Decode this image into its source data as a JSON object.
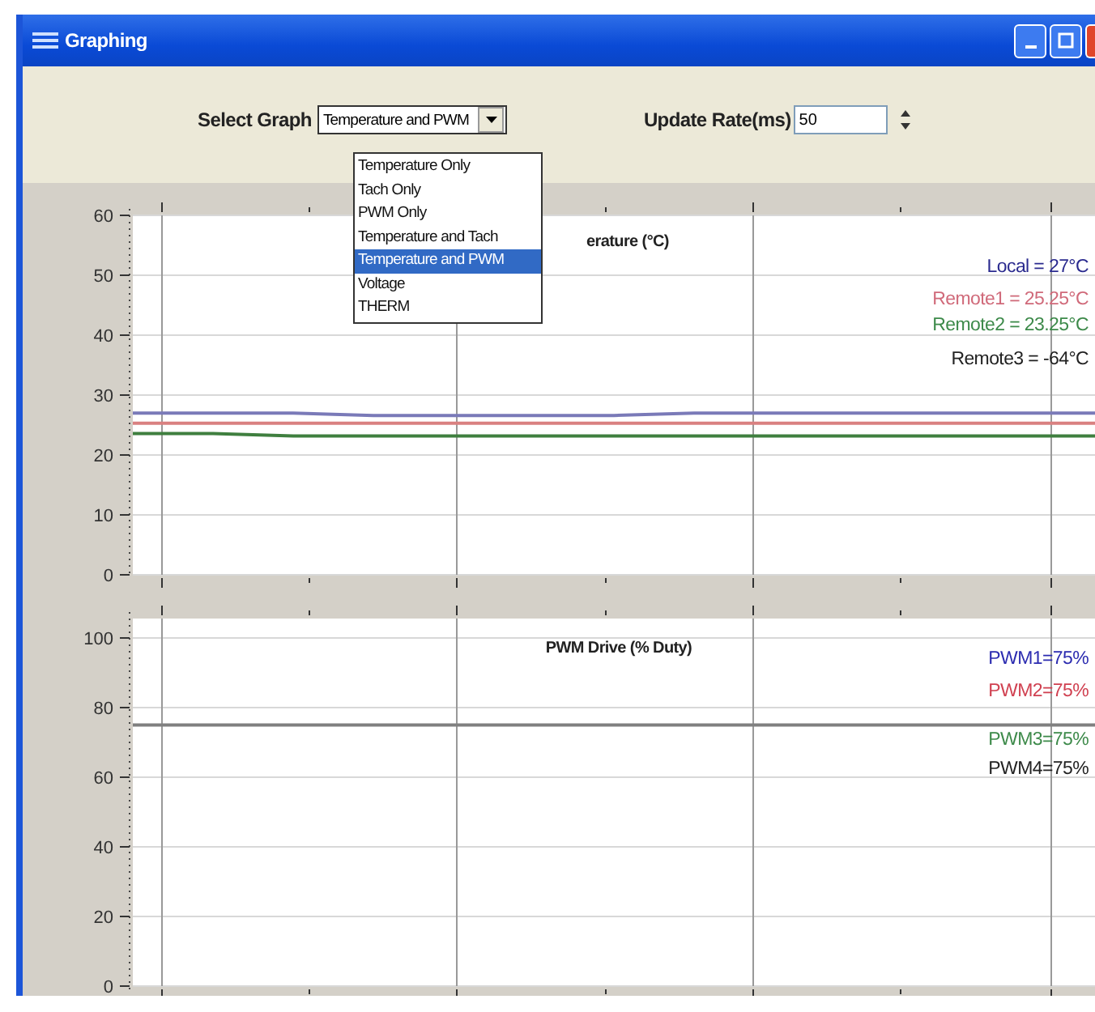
{
  "window": {
    "title": "Graphing"
  },
  "toolbar": {
    "graph_select": {
      "label": "Select Graph",
      "value": "Temperature and PWM",
      "expanded": true,
      "options": [
        {
          "label": "Temperature Only",
          "selected": false
        },
        {
          "label": "Tach Only",
          "selected": false
        },
        {
          "label": "PWM Only",
          "selected": false
        },
        {
          "label": "Temperature and Tach",
          "selected": false
        },
        {
          "label": "Temperature and PWM",
          "selected": true
        },
        {
          "label": "Voltage",
          "selected": false
        },
        {
          "label": "THERM",
          "selected": false
        }
      ]
    },
    "update_rate": {
      "label": "Update Rate(ms)",
      "value": "50"
    }
  },
  "charts": [
    {
      "chart_data": {
        "type": "line",
        "title": "erature (°C)",
        "grid": true,
        "ylim": [
          0,
          60
        ],
        "yticks": [
          0,
          10,
          20,
          30,
          40,
          50,
          60
        ],
        "series": [
          {
            "color": "#7a7ab8",
            "values": [
              27,
              27,
              27,
              26.6,
              26.6,
              26.6,
              26.6,
              27,
              27,
              27,
              27,
              27,
              27
            ]
          },
          {
            "color": "#d98080",
            "values": [
              25.3,
              25.3,
              25.3,
              25.3,
              25.3,
              25.3,
              25.3,
              25.3,
              25.3,
              25.3,
              25.3,
              25.3,
              25.3
            ]
          },
          {
            "color": "#3f7f3f",
            "values": [
              23.6,
              23.6,
              23.2,
              23.2,
              23.2,
              23.2,
              23.2,
              23.2,
              23.2,
              23.2,
              23.2,
              23.2,
              23.2
            ]
          }
        ]
      },
      "legend": [
        {
          "text": "Local = 27°C",
          "color": "#2b2b8f"
        },
        {
          "text": "Remote1 = 25.25°C",
          "color": "#d06a7a"
        },
        {
          "text": "Remote2 = 23.25°C",
          "color": "#3d8a4a"
        },
        {
          "text": "Remote3 = -64°C",
          "color": "#222222"
        }
      ]
    },
    {
      "chart_data": {
        "type": "line",
        "title": "PWM Drive (% Duty)",
        "grid": true,
        "ylim": [
          0,
          100
        ],
        "yticks": [
          0,
          20,
          40,
          60,
          80,
          100
        ],
        "series": [
          {
            "color": "#808080",
            "values": [
              75,
              75,
              75,
              75,
              75,
              75,
              75,
              75,
              75,
              75,
              75,
              75,
              75
            ]
          }
        ]
      },
      "legend": [
        {
          "text": "PWM1=75%",
          "color": "#2b2bb0"
        },
        {
          "text": "PWM2=75%",
          "color": "#d04050"
        },
        {
          "text": "PWM3=75%",
          "color": "#3d8a4a"
        },
        {
          "text": "PWM4=75%",
          "color": "#222222"
        }
      ]
    }
  ]
}
